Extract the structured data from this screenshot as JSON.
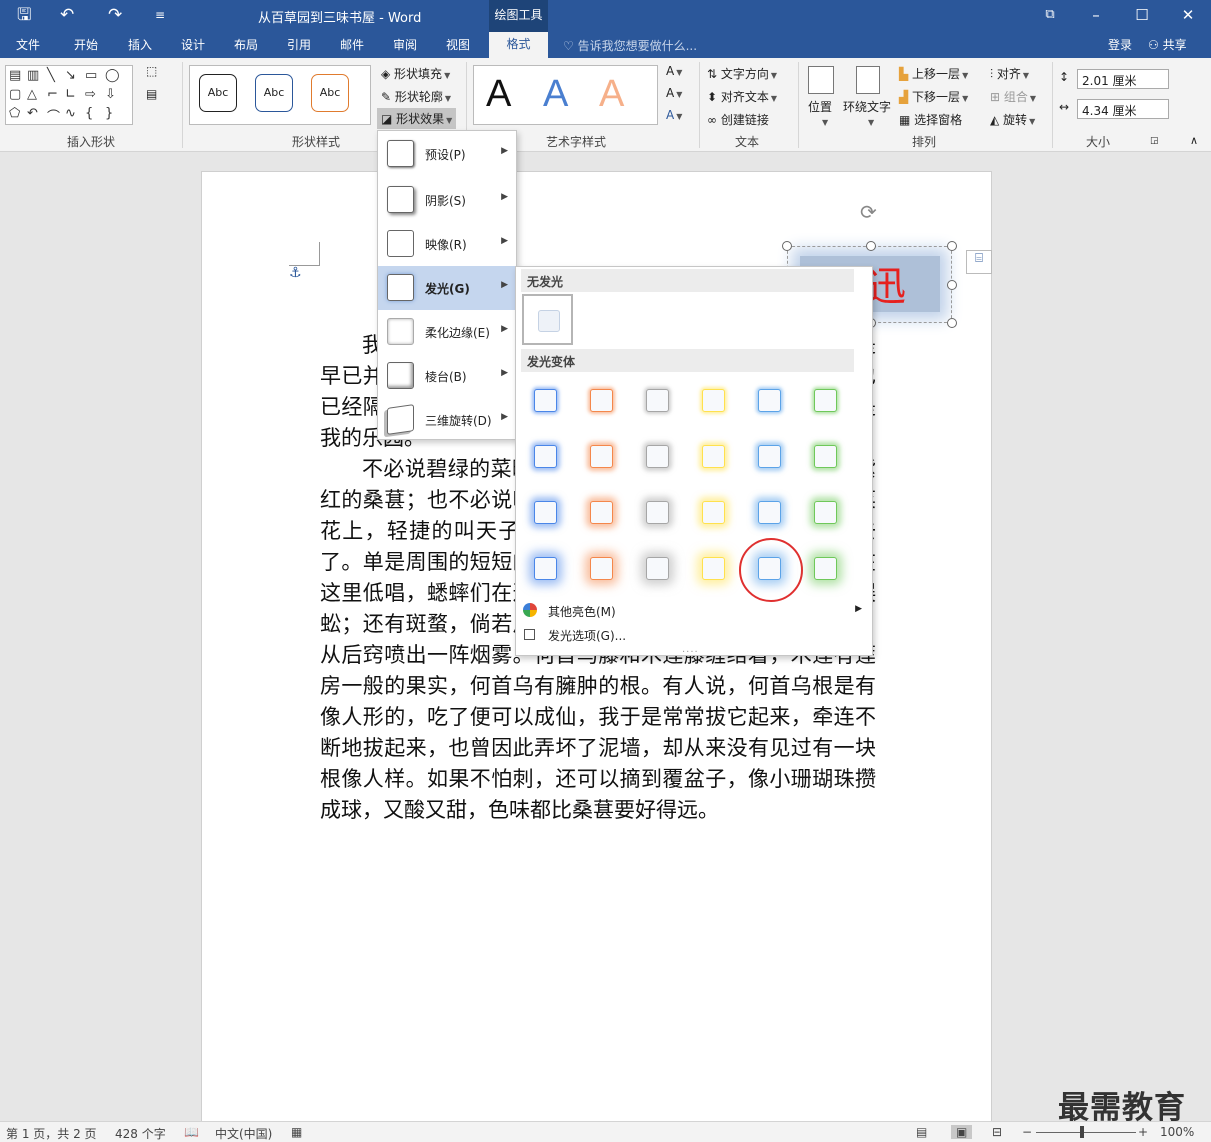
{
  "window": {
    "title": "从百草园到三味书屋 - Word",
    "context_tab": "绘图工具",
    "controls": {
      "ribbon_display": "⧉",
      "minimize": "–",
      "maximize": "☐",
      "close": "✕"
    }
  },
  "quick_access": {
    "save": "🖫",
    "undo": "↶",
    "redo": "↷",
    "customize": "≡"
  },
  "tabs": [
    "文件",
    "开始",
    "插入",
    "设计",
    "布局",
    "引用",
    "邮件",
    "审阅",
    "视图"
  ],
  "active_tab": "格式",
  "tell_me": "告诉我您想要做什么...",
  "account": {
    "login": "登录",
    "share": "共享"
  },
  "ribbon": {
    "insert_shapes": {
      "label": "插入形状"
    },
    "shape_styles": {
      "label": "形状样式",
      "thumb_text": "Abc",
      "fill": "形状填充",
      "outline": "形状轮廓",
      "effects": "形状效果"
    },
    "wordart": {
      "label": "艺术字样式",
      "letter": "A"
    },
    "text": {
      "label": "文本",
      "direction": "文字方向",
      "align": "对齐文本",
      "link": "创建链接"
    },
    "arrange": {
      "label": "排列",
      "position": "位置",
      "wrap": "环绕文字",
      "forward": "上移一层",
      "backward": "下移一层",
      "pane": "选择窗格",
      "align": "对齐",
      "group": "组合",
      "rotate": "旋转"
    },
    "size": {
      "label": "大小",
      "height": "2.01 厘米",
      "width": "4.34 厘米"
    }
  },
  "effects_menu": {
    "items": [
      {
        "label": "预设(P)"
      },
      {
        "label": "阴影(S)"
      },
      {
        "label": "映像(R)"
      },
      {
        "label": "发光(G)",
        "selected": true
      },
      {
        "label": "柔化边缘(E)"
      },
      {
        "label": "棱台(B)"
      },
      {
        "label": "三维旋转(D)"
      }
    ]
  },
  "glow_menu": {
    "no_glow_header": "无发光",
    "variations_header": "发光变体",
    "colors": [
      "#4a86e8",
      "#f4874b",
      "#a6a6a6",
      "#ffe14d",
      "#5ba3e8",
      "#6fc85a"
    ],
    "highlighted": {
      "row": 4,
      "col": 5
    },
    "more_colors": "其他亮色(M)",
    "options": "发光选项(G)..."
  },
  "shape": {
    "text": "迅"
  },
  "document": {
    "paragraphs": [
      {
        "indent": true,
        "text": "我家的后面有一个很大的园，相传叫作百草园。现在是早已并屋子一起卖给朱文公的子孙了，连那最末次的相见也已经隔了七八年，其中似乎确凿只有一些野草；但那时却是我的乐园。"
      },
      {
        "indent": true,
        "text": "不必说碧绿的菜畦，光滑的石井栏，高大的皂荚树，紫红的桑葚；也不必说鸣蝉在树叶里长吟，肥胖的黄蜂伏在菜花上，轻捷的叫天子（云雀）忽然从草间直窜向云霄里去了。单是周围的短短的泥墙根一带，就有无限趣味。油蛉在这里低唱，蟋蟀们在这里弹琴。翻开断砖来，有时会遇见蜈蚣；还有斑蝥，倘若用手指按住它的脊梁，便会啪的一声，从后窍喷出一阵烟雾。何首乌藤和木莲藤缠络着，木莲有莲房一般的果实，何首乌有臃肿的根。有人说，何首乌根是有像人形的，吃了便可以成仙，我于是常常拔它起来，牵连不断地拔起来，也曾因此弄坏了泥墙，却从来没有见过有一块根像人样。如果不怕刺，还可以摘到覆盆子，像小珊瑚珠攒成球，又酸又甜，色味都比桑葚要好得远。"
      }
    ]
  },
  "status": {
    "page": "第 1 页，共 2 页",
    "words": "428 个字",
    "language": "中文(中国)",
    "zoom": "100%"
  },
  "watermark": "最需教育"
}
